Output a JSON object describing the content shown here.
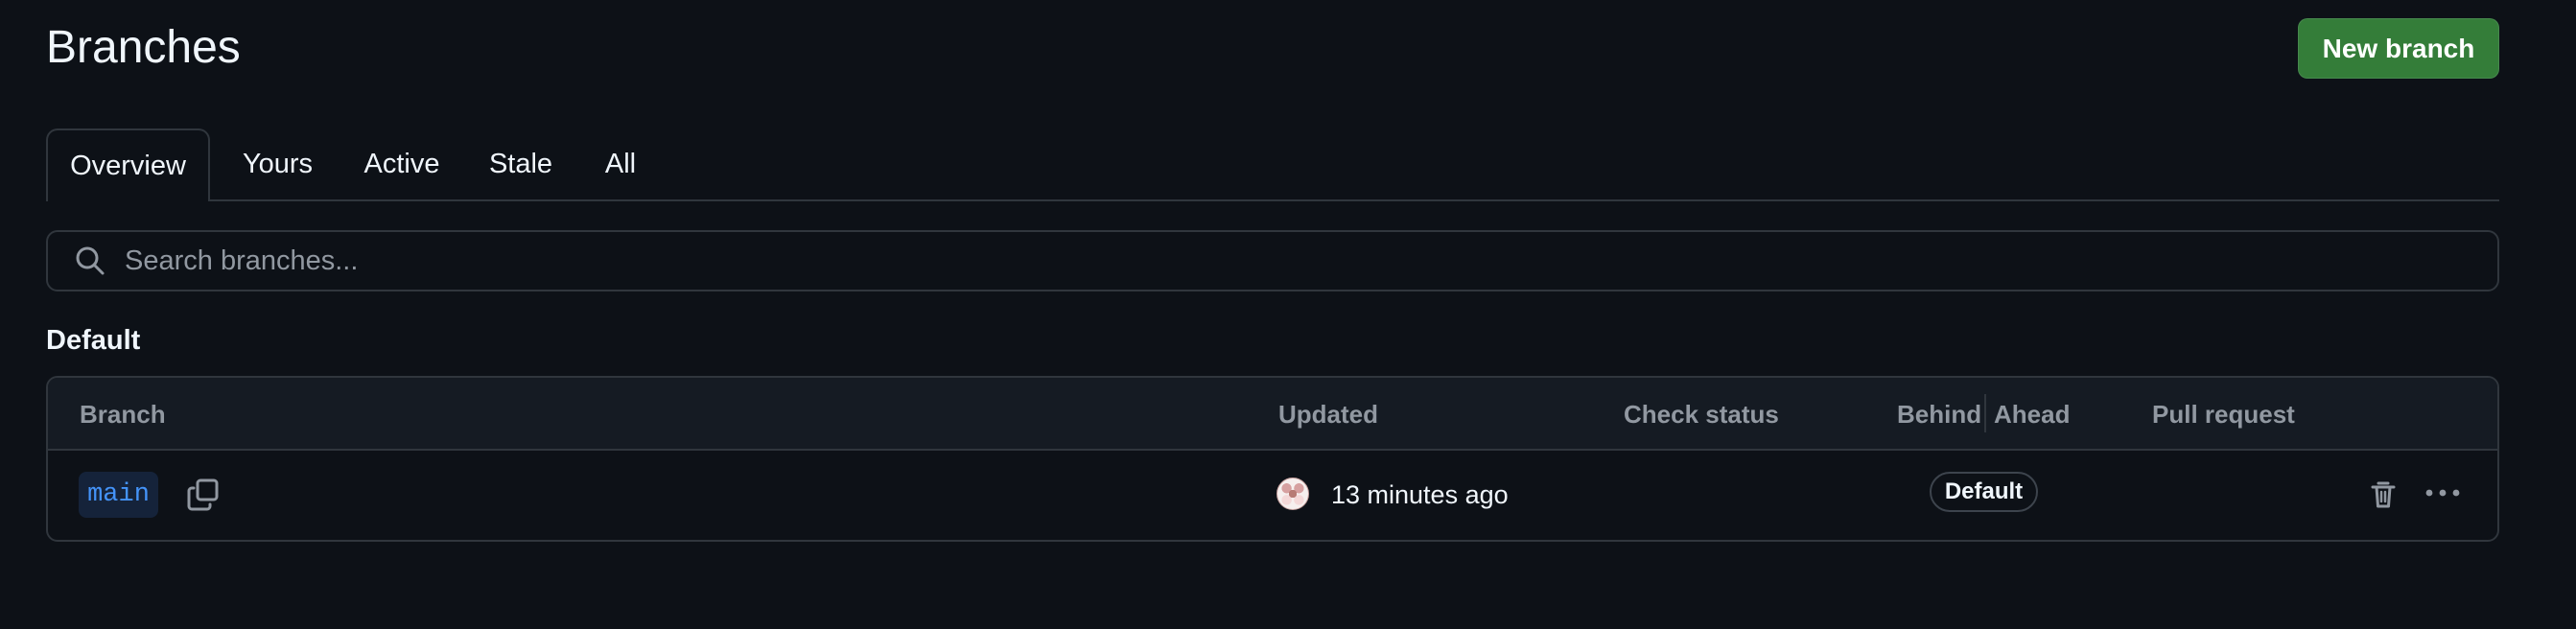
{
  "header": {
    "title": "Branches",
    "new_branch_label": "New branch"
  },
  "tabs": [
    {
      "label": "Overview",
      "selected": true
    },
    {
      "label": "Yours",
      "selected": false
    },
    {
      "label": "Active",
      "selected": false
    },
    {
      "label": "Stale",
      "selected": false
    },
    {
      "label": "All",
      "selected": false
    }
  ],
  "search": {
    "placeholder": "Search branches...",
    "value": "",
    "icon": "search-icon"
  },
  "default_section": {
    "title": "Default",
    "columns": {
      "branch": "Branch",
      "updated": "Updated",
      "check_status": "Check status",
      "behind": "Behind",
      "ahead": "Ahead",
      "pull_request": "Pull request"
    },
    "rows": [
      {
        "branch": "main",
        "copy_icon": "copy-icon",
        "updated": "13 minutes ago",
        "avatar": "user-avatar",
        "check_status": "",
        "behind_ahead_badge": "Default",
        "pull_request": "",
        "delete_icon": "trash-icon",
        "more_icon": "more-horizontal-icon"
      }
    ]
  },
  "colors": {
    "background": "#0d1117",
    "border": "#30363d",
    "table_header": "#151b23",
    "primary_button": "#347d39",
    "branch_link": "#4493f8",
    "muted_text": "#9198a1"
  }
}
